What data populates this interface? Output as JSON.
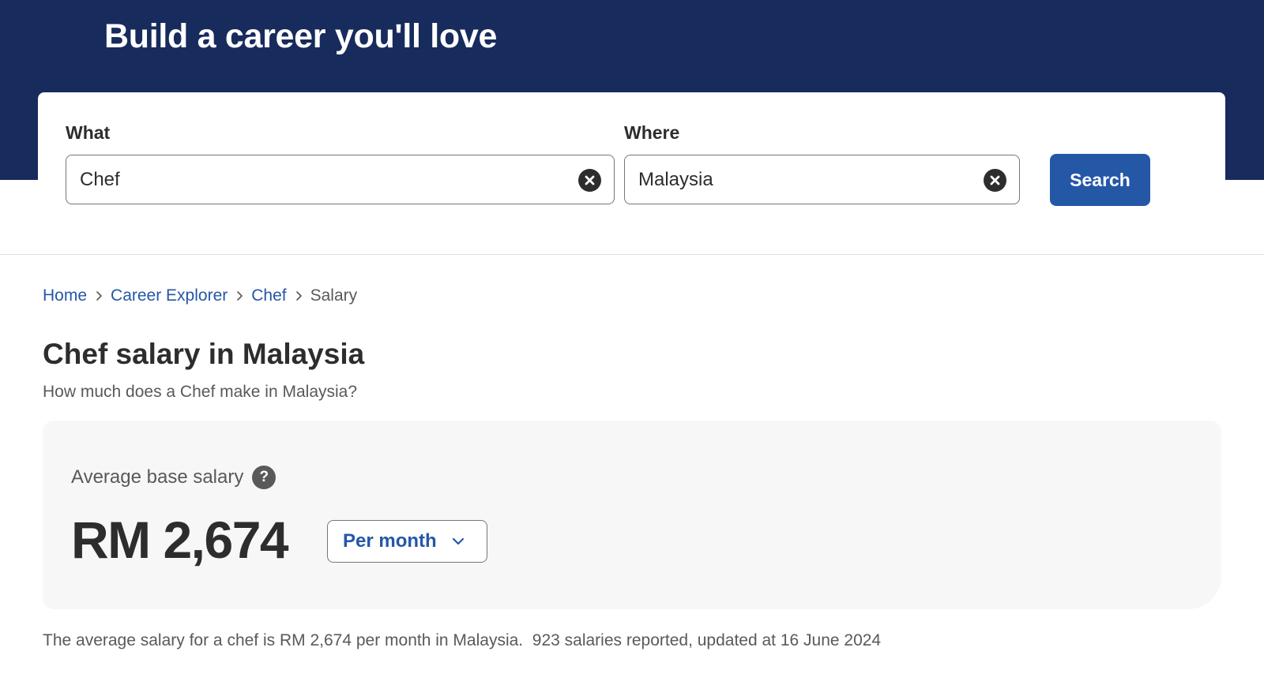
{
  "hero": {
    "title": "Build a career you'll love"
  },
  "search": {
    "what_label": "What",
    "what_value": "Chef",
    "where_label": "Where",
    "where_value": "Malaysia",
    "search_button": "Search",
    "clear_icon": "close-circle-icon"
  },
  "breadcrumb": {
    "items": [
      "Home",
      "Career Explorer",
      "Chef"
    ],
    "current": "Salary",
    "separator_icon": "chevron-right-icon"
  },
  "page": {
    "title": "Chef salary in Malaysia",
    "subtitle": "How much does a Chef make in Malaysia?"
  },
  "salary": {
    "label": "Average base salary",
    "help_icon": "?",
    "amount": "RM 2,674",
    "period": "Per month",
    "period_icon": "chevron-down-icon"
  },
  "summary": {
    "text": "The average salary for a chef is RM 2,674 per month in Malaysia.  923 salaries reported, updated at 16 June 2024"
  },
  "colors": {
    "hero_background": "#172b5c",
    "accent": "#2557a7",
    "card_background": "#f7f7f7",
    "text": "#2d2d2d",
    "muted_text": "#595959"
  }
}
